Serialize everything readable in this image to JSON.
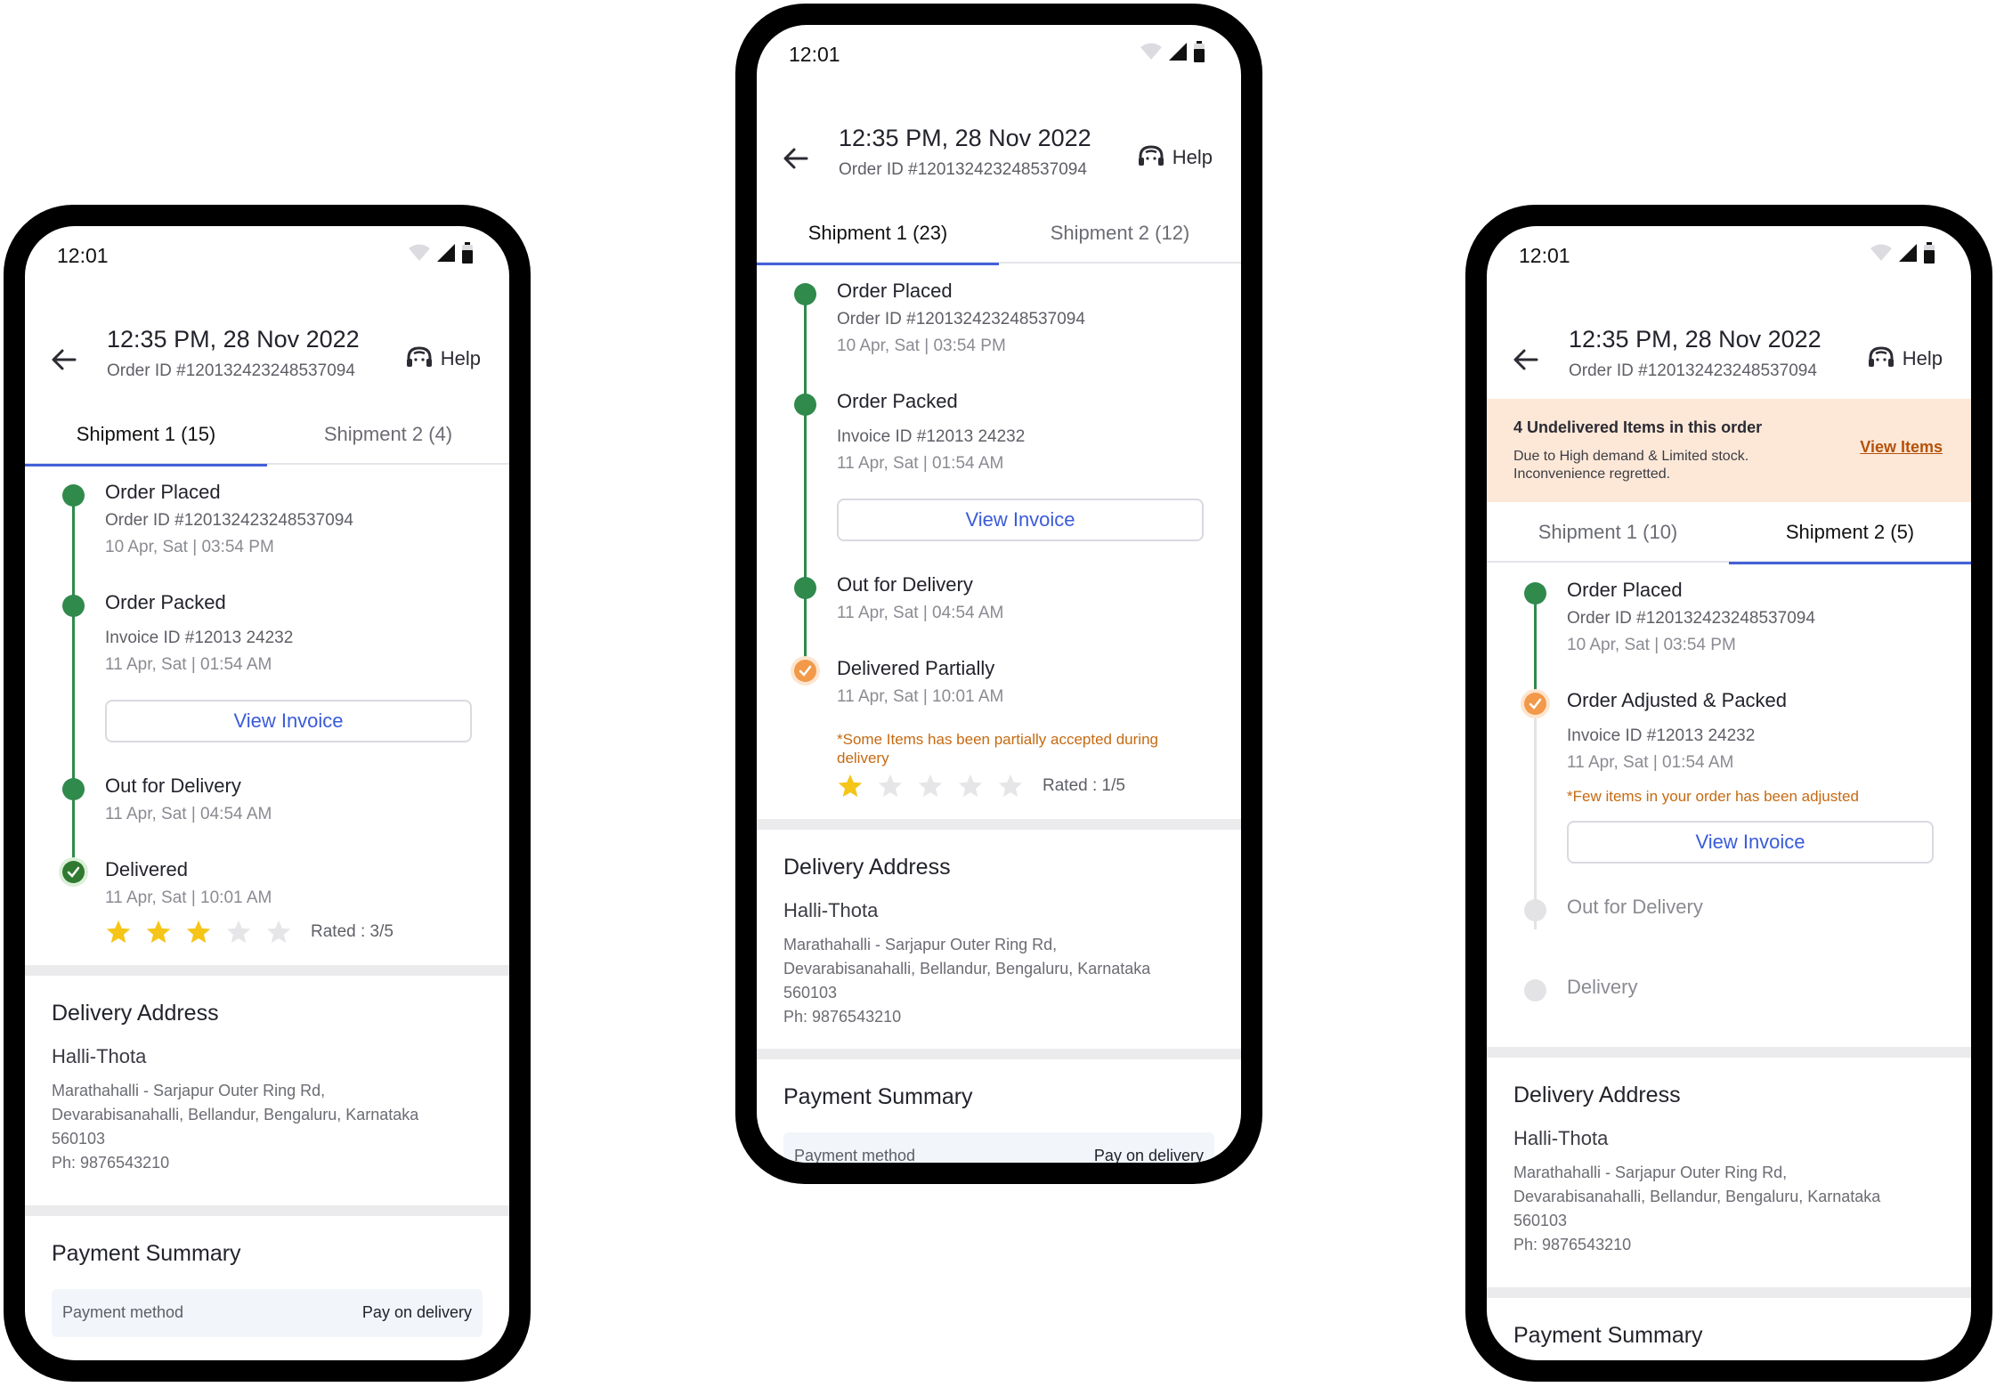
{
  "screens": [
    {
      "status_time": "12:01",
      "header": {
        "title": "12:35 PM, 28 Nov 2022",
        "order_id": "Order ID #120132423248537094",
        "help": "Help"
      },
      "tabs": [
        "Shipment 1 (15)",
        "Shipment 2 (4)"
      ],
      "active_tab": 0,
      "steps": [
        {
          "title": "Order Placed",
          "lines": [
            "Order ID #120132423248537094",
            "10 Apr, Sat | 03:54 PM"
          ],
          "state": "done"
        },
        {
          "title": "Order Packed",
          "lines": [
            "Invoice ID #12013 24232",
            "11 Apr, Sat | 01:54 AM"
          ],
          "state": "done",
          "button": "View Invoice"
        },
        {
          "title": "Out for Delivery",
          "lines": [
            "11 Apr, Sat | 04:54 AM"
          ],
          "state": "done"
        },
        {
          "title": "Delivered",
          "lines": [
            "11 Apr, Sat | 10:01 AM"
          ],
          "state": "delivered"
        }
      ],
      "rating": {
        "value": 3,
        "max": 5,
        "label": "Rated : 3/5"
      },
      "address": {
        "title": "Delivery Address",
        "name": "Halli-Thota",
        "lines": [
          "Marathahalli - Sarjapur Outer Ring Rd,",
          "Devarabisanahalli, Bellandur, Bengaluru, Karnataka",
          "560103",
          "Ph: 9876543210"
        ]
      },
      "payment": {
        "title": "Payment Summary",
        "label": "Payment method",
        "value": "Pay on delivery"
      }
    },
    {
      "status_time": "12:01",
      "header": {
        "title": "12:35 PM, 28 Nov 2022",
        "order_id": "Order ID #120132423248537094",
        "help": "Help"
      },
      "tabs": [
        "Shipment 1 (23)",
        "Shipment 2 (12)"
      ],
      "active_tab": 0,
      "steps": [
        {
          "title": "Order Placed",
          "lines": [
            "Order ID #120132423248537094",
            "10 Apr, Sat | 03:54 PM"
          ],
          "state": "done"
        },
        {
          "title": "Order Packed",
          "lines": [
            "Invoice ID #12013 24232",
            "11 Apr, Sat | 01:54 AM"
          ],
          "state": "done",
          "button": "View Invoice"
        },
        {
          "title": "Out for Delivery",
          "lines": [
            "11 Apr, Sat | 04:54 AM"
          ],
          "state": "done"
        },
        {
          "title": "Delivered Partially",
          "lines": [
            "11 Apr, Sat | 10:01 AM"
          ],
          "state": "partial",
          "note": "*Some Items has been partially accepted during delivery"
        }
      ],
      "rating": {
        "value": 1,
        "max": 5,
        "label": "Rated : 1/5"
      },
      "address": {
        "title": "Delivery Address",
        "name": "Halli-Thota",
        "lines": [
          "Marathahalli - Sarjapur Outer Ring Rd,",
          "Devarabisanahalli, Bellandur, Bengaluru, Karnataka",
          "560103",
          "Ph: 9876543210"
        ]
      },
      "payment": {
        "title": "Payment Summary",
        "label": "Payment method",
        "value": "Pay on delivery"
      }
    },
    {
      "status_time": "12:01",
      "header": {
        "title": "12:35 PM, 28 Nov 2022",
        "order_id": "Order ID #120132423248537094",
        "help": "Help"
      },
      "banner": {
        "title": "4 Undelivered Items in this order",
        "text": "Due to High demand & Limited stock. Inconvenience regretted.",
        "link": "View Items"
      },
      "tabs": [
        "Shipment 1 (10)",
        "Shipment 2 (5)"
      ],
      "active_tab": 1,
      "steps": [
        {
          "title": "Order Placed",
          "lines": [
            "Order ID #120132423248537094",
            "10 Apr, Sat | 03:54 PM"
          ],
          "state": "done"
        },
        {
          "title": "Order Adjusted & Packed",
          "lines": [
            "Invoice ID #12013 24232",
            "11 Apr, Sat | 01:54 AM"
          ],
          "state": "adjusted",
          "note": "*Few items in your order has been adjusted",
          "button": "View Invoice"
        },
        {
          "title": "Out for Delivery",
          "lines": [],
          "state": "pending"
        },
        {
          "title": "Delivery",
          "lines": [],
          "state": "pending"
        }
      ],
      "address": {
        "title": "Delivery Address",
        "name": "Halli-Thota",
        "lines": [
          "Marathahalli - Sarjapur Outer Ring Rd,",
          "Devarabisanahalli, Bellandur, Bengaluru, Karnataka",
          "560103",
          "Ph: 9876543210"
        ]
      },
      "payment": {
        "title": "Payment Summary"
      }
    }
  ],
  "colors": {
    "accent": "#4461d8",
    "success": "#2f8a4c",
    "warning": "#f2994a",
    "star": "#f5c518",
    "banner_bg": "#fde8d8"
  },
  "icons": [
    "back-arrow-icon",
    "headset-icon",
    "wifi-icon",
    "signal-icon",
    "battery-icon",
    "check-icon",
    "star-icon"
  ]
}
